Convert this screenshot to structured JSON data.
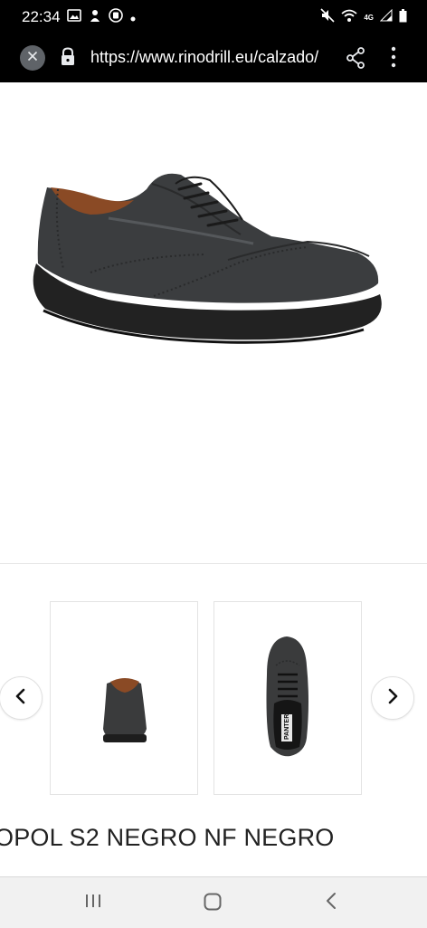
{
  "status_bar": {
    "time": "22:34",
    "network": "4G"
  },
  "browser": {
    "url": "https://www.rinodrill.eu/calzado/"
  },
  "product": {
    "title": "OPOL S2 NEGRO NF NEGRO",
    "thumb_logo": "PANTER"
  },
  "icons": {
    "close": "close-icon",
    "lock": "lock-icon",
    "share": "share-icon",
    "menu": "more-vert-icon",
    "prev": "chevron-left-icon",
    "next": "chevron-right-icon",
    "nav_recents": "recents-icon",
    "nav_home": "home-icon",
    "nav_back": "back-icon"
  },
  "colors": {
    "status_bar_bg": "#000000",
    "toolbar_bg": "#000000",
    "page_bg": "#ffffff",
    "nav_bar_bg": "#f1f1f1"
  }
}
